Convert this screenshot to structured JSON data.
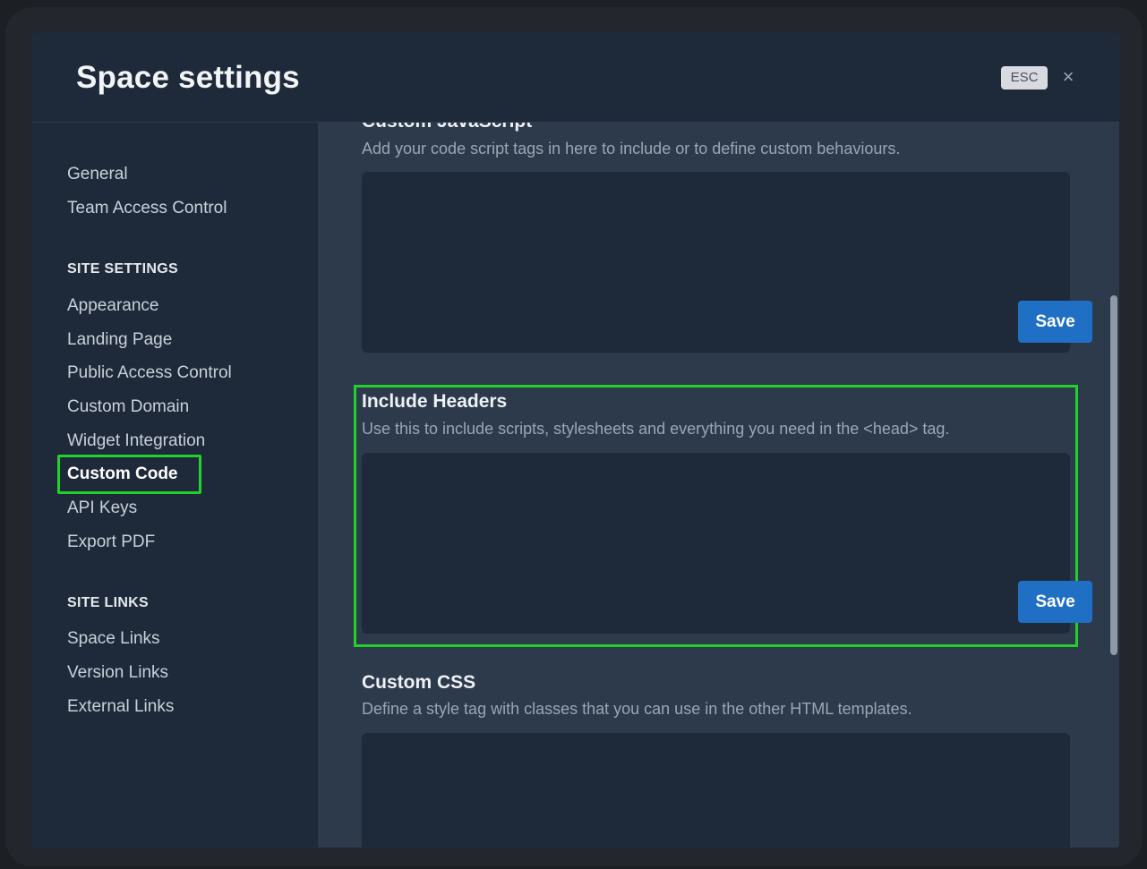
{
  "header": {
    "title": "Space settings",
    "esc_label": "ESC",
    "close_glyph": "×"
  },
  "sidebar": {
    "items_top": [
      "General",
      "Team Access Control"
    ],
    "site_settings_heading": "SITE SETTINGS",
    "site_settings_items": [
      "Appearance",
      "Landing Page",
      "Public Access Control",
      "Custom Domain",
      "Widget Integration",
      "Custom Code",
      "API Keys",
      "Export PDF"
    ],
    "active_item": "Custom Code",
    "site_links_heading": "SITE LINKS",
    "site_links_items": [
      "Space Links",
      "Version Links",
      "External Links"
    ]
  },
  "content": {
    "custom_js": {
      "title": "Custom JavaScript",
      "description": "Add your code script tags in here to include or to define custom behaviours.",
      "save_label": "Save"
    },
    "include_headers": {
      "title": "Include Headers",
      "description": "Use this to include scripts, stylesheets and everything you need in the <head> tag.",
      "save_label": "Save"
    },
    "custom_css": {
      "title": "Custom CSS",
      "description": "Define a style tag with classes that you can use in the other HTML templates."
    }
  },
  "colors": {
    "highlight": "#22d12b",
    "button": "#1f6fc4",
    "panel": "#2d3a4b",
    "sidebar": "#1e2a3a"
  }
}
